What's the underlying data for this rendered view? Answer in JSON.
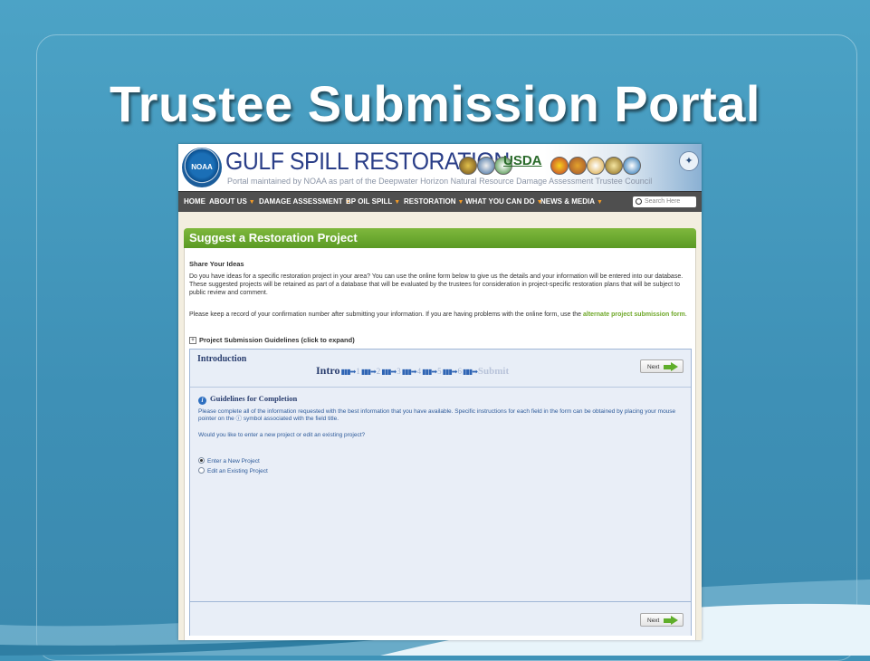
{
  "slide": {
    "title": "Trustee Submission Portal"
  },
  "site": {
    "logo_text": "NOAA",
    "title": "GULF SPILL RESTORATION",
    "subtitle": "Portal maintained by NOAA as part of the Deepwater Horizon Natural Resource Damage Assessment Trustee Council",
    "usda_text": "USDA"
  },
  "nav": {
    "items": [
      {
        "label": "HOME",
        "dropdown": false
      },
      {
        "label": "ABOUT US",
        "dropdown": true
      },
      {
        "label": "DAMAGE ASSESSMENT",
        "dropdown": true
      },
      {
        "label": "BP OIL SPILL",
        "dropdown": true
      },
      {
        "label": "RESTORATION",
        "dropdown": true
      },
      {
        "label": "WHAT YOU CAN DO",
        "dropdown": true
      },
      {
        "label": "NEWS & MEDIA",
        "dropdown": true
      }
    ],
    "search_placeholder": "Search Here"
  },
  "page": {
    "heading": "Suggest a Restoration Project",
    "share_heading": "Share Your Ideas",
    "para1": "Do you have ideas for a specific restoration project in your area? You can use the online form below to give us the details and your information will be entered into our database. These suggested projects will be retained as part of a database that will be evaluated by the trustees for consideration in project-specific restoration plans that will be subject to public review and comment.",
    "para2_before": "Please keep a record of your confirmation number after submitting your information. If you are having problems with the online form, use the ",
    "para2_link": "alternate project submission form",
    "para2_after": ".",
    "guidelines_toggle": "Project Submission Guidelines (click to expand)"
  },
  "form": {
    "section_title": "Introduction",
    "steps": {
      "current": "Intro",
      "numbers": [
        "1",
        "2",
        "3",
        "4",
        "5",
        "6"
      ],
      "final": "Submit"
    },
    "next_label": "Next",
    "guide_title": "Guidelines for Completion",
    "guide_text": "Please complete all of the information requested with the best information that you have available. Specific instructions for each field in the form can be obtained by placing your mouse pointer on the ⓘ symbol associated with the field title.",
    "question": "Would you like to enter a new project or edit an existing project?",
    "options": [
      {
        "label": "Enter a New Project",
        "selected": true
      },
      {
        "label": "Edit an Existing Project",
        "selected": false
      }
    ]
  },
  "colors": {
    "slide_bg": "#3f93b8",
    "nav_bg": "#4f4f4f",
    "header_green": "#5a9a24",
    "link_green": "#6fa829",
    "form_blue": "#2a3e6f"
  }
}
